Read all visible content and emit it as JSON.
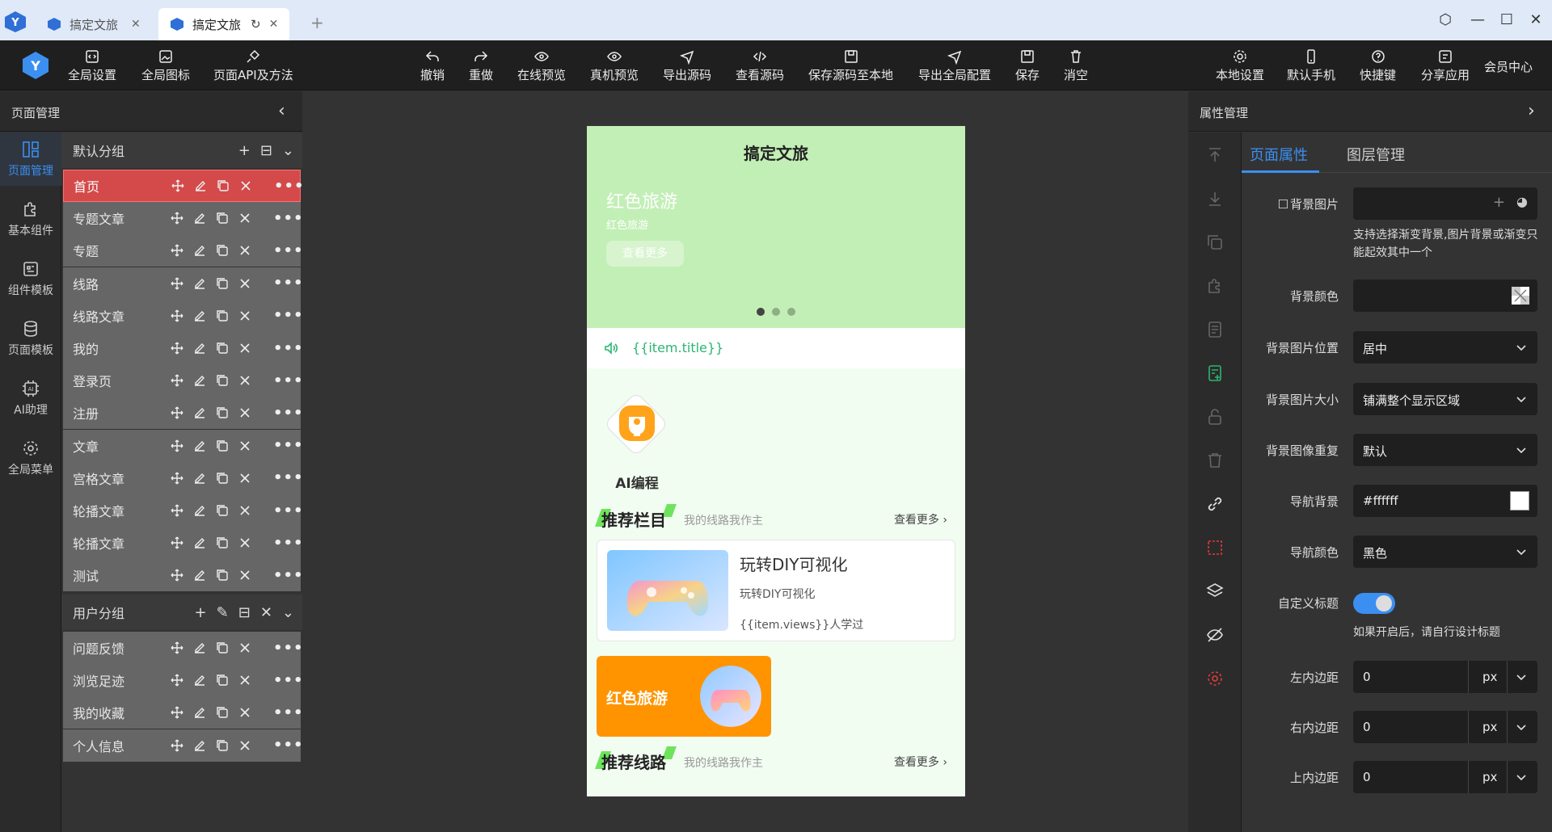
{
  "window": {
    "tabs": [
      {
        "label": "搞定文旅",
        "active": false
      },
      {
        "label": "搞定文旅",
        "active": true
      }
    ]
  },
  "toolbar": {
    "left": [
      "全局设置",
      "全局图标",
      "页面API及方法"
    ],
    "center": [
      "撤销",
      "重做",
      "在线预览",
      "真机预览",
      "导出源码",
      "查看源码",
      "保存源码至本地",
      "导出全局配置",
      "保存",
      "消空"
    ],
    "right": [
      "本地设置",
      "默认手机",
      "快捷键",
      "分享应用"
    ],
    "member": "会员中心"
  },
  "left_panel": {
    "title": "页面管理",
    "nav": [
      "页面管理",
      "基本组件",
      "组件模板",
      "页面模板",
      "AI助理",
      "全局菜单"
    ],
    "groups": [
      {
        "name": "默认分组",
        "pages": [
          "首页",
          "专题文章",
          "专题",
          "线路",
          "线路文章",
          "我的",
          "登录页",
          "注册",
          "文章",
          "宫格文章",
          "轮播文章",
          "轮播文章",
          "测试"
        ]
      },
      {
        "name": "用户分组",
        "pages": [
          "问题反馈",
          "浏览足迹",
          "我的收藏",
          "个人信息"
        ]
      }
    ],
    "active_page": "首页"
  },
  "phone": {
    "title": "搞定文旅",
    "banner": {
      "heading": "红色旅游",
      "sub": "红色旅游",
      "button": "查看更多"
    },
    "notice": "{{item.title}}",
    "ai_label": "AI编程",
    "section1": {
      "title": "推荐栏目",
      "sub": "我的线路我作主",
      "more": "查看更多 ›"
    },
    "card": {
      "title": "玩转DIY可视化",
      "desc": "玩转DIY可视化",
      "views": "{{item.views}}人学过"
    },
    "promo": "红色旅游",
    "section2": {
      "title": "推荐线路",
      "sub": "我的线路我作主",
      "more": "查看更多 ›"
    }
  },
  "right_panel": {
    "title": "属性管理",
    "tabs": [
      "页面属性",
      "图层管理"
    ],
    "props": {
      "bg_image_label": "背景图片",
      "bg_image_hint": "支持选择渐变背景,图片背景或渐变只能起效其中一个",
      "bg_color_label": "背景颜色",
      "bg_pos_label": "背景图片位置",
      "bg_pos_value": "居中",
      "bg_size_label": "背景图片大小",
      "bg_size_value": "铺满整个显示区域",
      "bg_repeat_label": "背景图像重复",
      "bg_repeat_value": "默认",
      "nav_bg_label": "导航背景",
      "nav_bg_value": "#ffffff",
      "nav_color_label": "导航颜色",
      "nav_color_value": "黑色",
      "custom_title_label": "自定义标题",
      "custom_title_on": true,
      "custom_title_hint": "如果开启后，请自行设计标题",
      "pad_left_label": "左内边距",
      "pad_left_value": "0",
      "pad_right_label": "右内边距",
      "pad_right_value": "0",
      "pad_top_label": "上内边距",
      "pad_top_value": "0",
      "unit": "px"
    }
  },
  "colors": {
    "accent": "#3b8ff0",
    "active_row": "#d44a4a",
    "banner": "#c2efb6",
    "promo": "#ff9400"
  }
}
